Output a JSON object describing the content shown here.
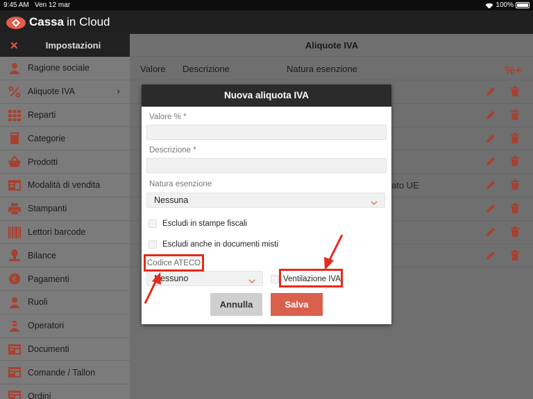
{
  "status_bar": {
    "time": "9:45 AM",
    "date": "Ven 12 mar",
    "battery": "100%"
  },
  "app": {
    "brand_bold": "Cassa",
    "brand_light": "in Cloud"
  },
  "sidebar": {
    "title": "Impostazioni",
    "items": [
      {
        "label": "Ragione sociale",
        "icon": "person-icon"
      },
      {
        "label": "Aliquote IVA",
        "icon": "percent-icon"
      },
      {
        "label": "Reparti",
        "icon": "grid-icon"
      },
      {
        "label": "Categorie",
        "icon": "book-icon"
      },
      {
        "label": "Prodotti",
        "icon": "basket-icon"
      },
      {
        "label": "Modalità di vendita",
        "icon": "window-icon"
      },
      {
        "label": "Stampanti",
        "icon": "printer-icon"
      },
      {
        "label": "Lettori barcode",
        "icon": "barcode-icon"
      },
      {
        "label": "Bilance",
        "icon": "scale-icon"
      },
      {
        "label": "Pagamenti",
        "icon": "euro-icon"
      },
      {
        "label": "Ruoli",
        "icon": "person-icon"
      },
      {
        "label": "Operatori",
        "icon": "operator-icon"
      },
      {
        "label": "Documenti",
        "icon": "document-icon"
      },
      {
        "label": "Comande / Tallon",
        "icon": "document-icon"
      },
      {
        "label": "Ordini",
        "icon": "document-icon"
      }
    ]
  },
  "main": {
    "title": "Aliquote IVA",
    "columns": {
      "value": "Valore",
      "description": "Descrizione",
      "exemption": "Natura esenzione"
    },
    "add_icon": "%+",
    "rows": [
      {
        "text": ""
      },
      {
        "text": ""
      },
      {
        "text": ""
      },
      {
        "text": ""
      },
      {
        "text": "ato UE"
      },
      {
        "text": ""
      },
      {
        "text": ""
      },
      {
        "text": ""
      }
    ]
  },
  "modal": {
    "title": "Nuova aliquota IVA",
    "value_label": "Valore % *",
    "value_input": "",
    "description_label": "Descrizione *",
    "description_input": "",
    "exemption_label": "Natura esenzione",
    "exemption_selected": "Nessuna",
    "checkbox1": "Escludi in stampe fiscali",
    "checkbox2": "Escludi anche in documenti misti",
    "ateco_label": "Codice ATECO",
    "ateco_selected": "Nessuno",
    "ventilation_label": "Ventilazione IVA",
    "cancel_label": "Annulla",
    "save_label": "Salva"
  },
  "colors": {
    "accent": "#d9604d",
    "dark_header": "#2b2b2b",
    "highlight": "#e8281a"
  }
}
